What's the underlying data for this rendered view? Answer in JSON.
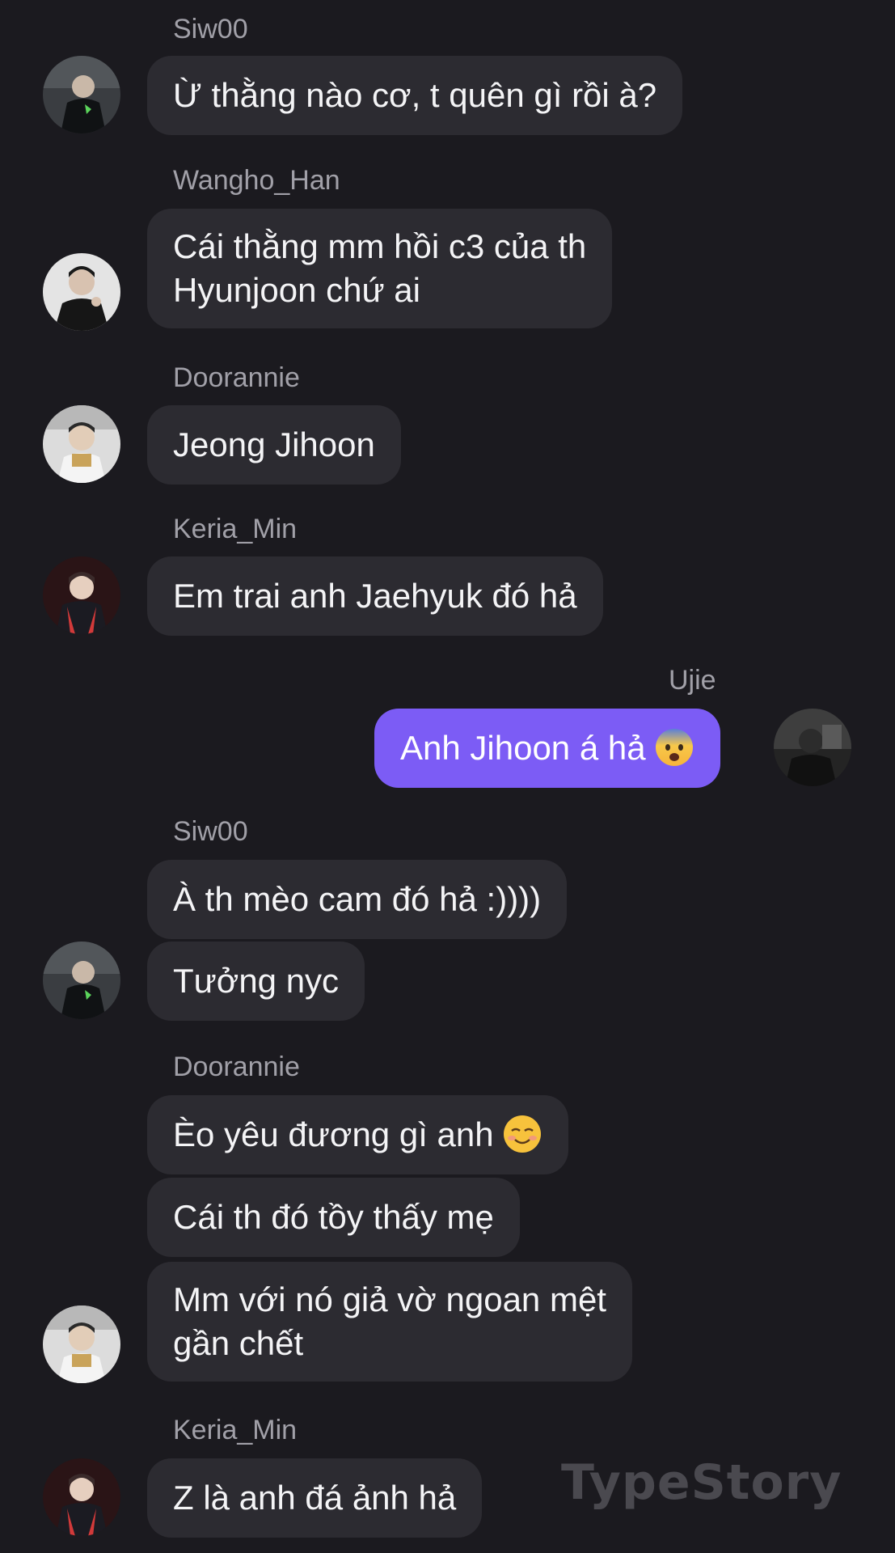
{
  "messages": [
    {
      "sender": "Siw00",
      "text": "Ừ thằng nào cơ, t quên gì rồi à?"
    },
    {
      "sender": "Wangho_Han",
      "text_line1": "Cái thằng mm hồi c3 của th",
      "text_line2": "Hyunjoon chứ ai"
    },
    {
      "sender": "Doorannie",
      "text": "Jeong Jihoon"
    },
    {
      "sender": "Keria_Min",
      "text": "Em trai anh Jaehyuk đó hả"
    },
    {
      "sender": "Ujie",
      "text": "Anh Jihoon á hả",
      "emoji": "fearful-face-emoji"
    },
    {
      "sender": "Siw00",
      "text1": "À th mèo cam đó hả :))))",
      "text2": "Tưởng nyc"
    },
    {
      "sender": "Doorannie",
      "text1": "Èo yêu đương gì anh",
      "emoji": "smiling-face-emoji",
      "text2": "Cái th đó tồy thấy mẹ",
      "text3_line1": "Mm với nó giả vờ ngoan mệt",
      "text3_line2": "gần chết"
    },
    {
      "sender": "Keria_Min",
      "text": "Z là anh đá ảnh hả"
    }
  ],
  "watermark": "TypeStory",
  "colors": {
    "background": "#1b1a1f",
    "bubble": "#2c2b31",
    "my_bubble": "#7c5cf5",
    "name": "#a1a0a8"
  }
}
